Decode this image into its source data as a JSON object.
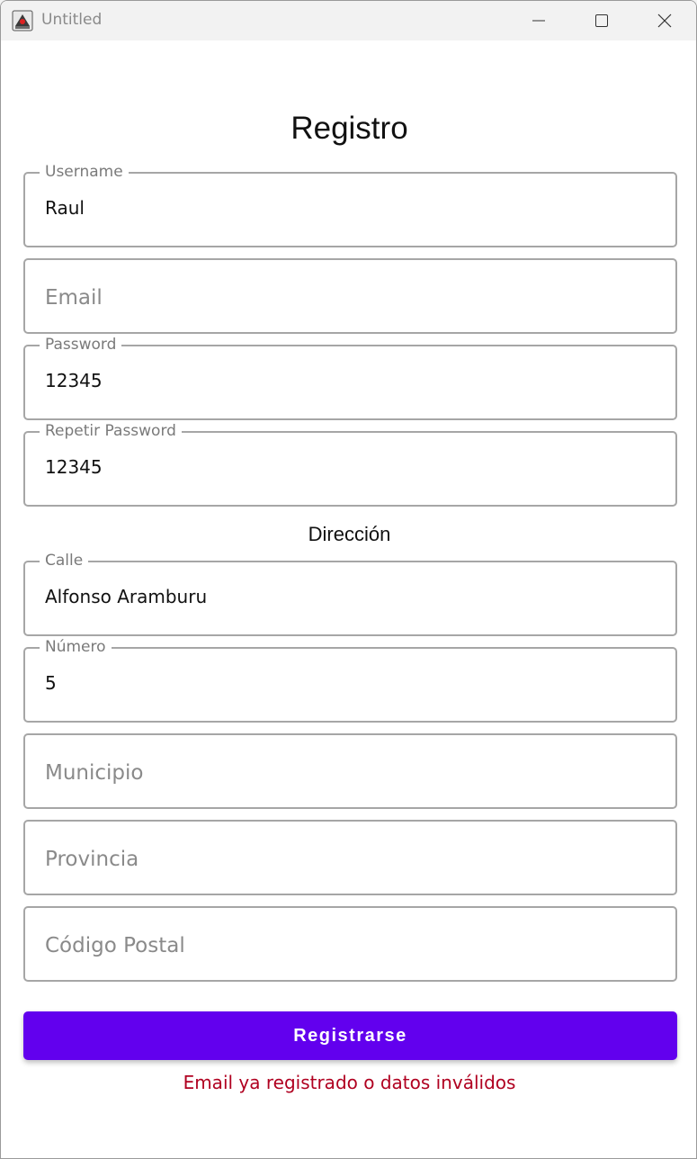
{
  "window": {
    "title": "Untitled"
  },
  "form": {
    "title": "Registro",
    "username": {
      "label": "Username",
      "value": "Raul"
    },
    "email": {
      "placeholder": "Email"
    },
    "password": {
      "label": "Password",
      "value": "12345"
    },
    "repeat_password": {
      "label": "Repetir Password",
      "value": "12345"
    },
    "address_title": "Dirección",
    "street": {
      "label": "Calle",
      "value": "Alfonso Aramburu"
    },
    "number": {
      "label": "Número",
      "value": "5"
    },
    "municipality": {
      "placeholder": "Municipio"
    },
    "province": {
      "placeholder": "Provincia"
    },
    "postal_code": {
      "placeholder": "Código Postal"
    },
    "submit_label": "Registrarse",
    "error_message": "Email ya registrado o datos inválidos"
  },
  "colors": {
    "accent": "#6200ee",
    "error": "#b00020",
    "border": "#a6a6a6"
  },
  "icons": {
    "app": "java-app-icon",
    "minimize": "minimize-icon",
    "maximize": "maximize-icon",
    "close": "close-icon"
  }
}
